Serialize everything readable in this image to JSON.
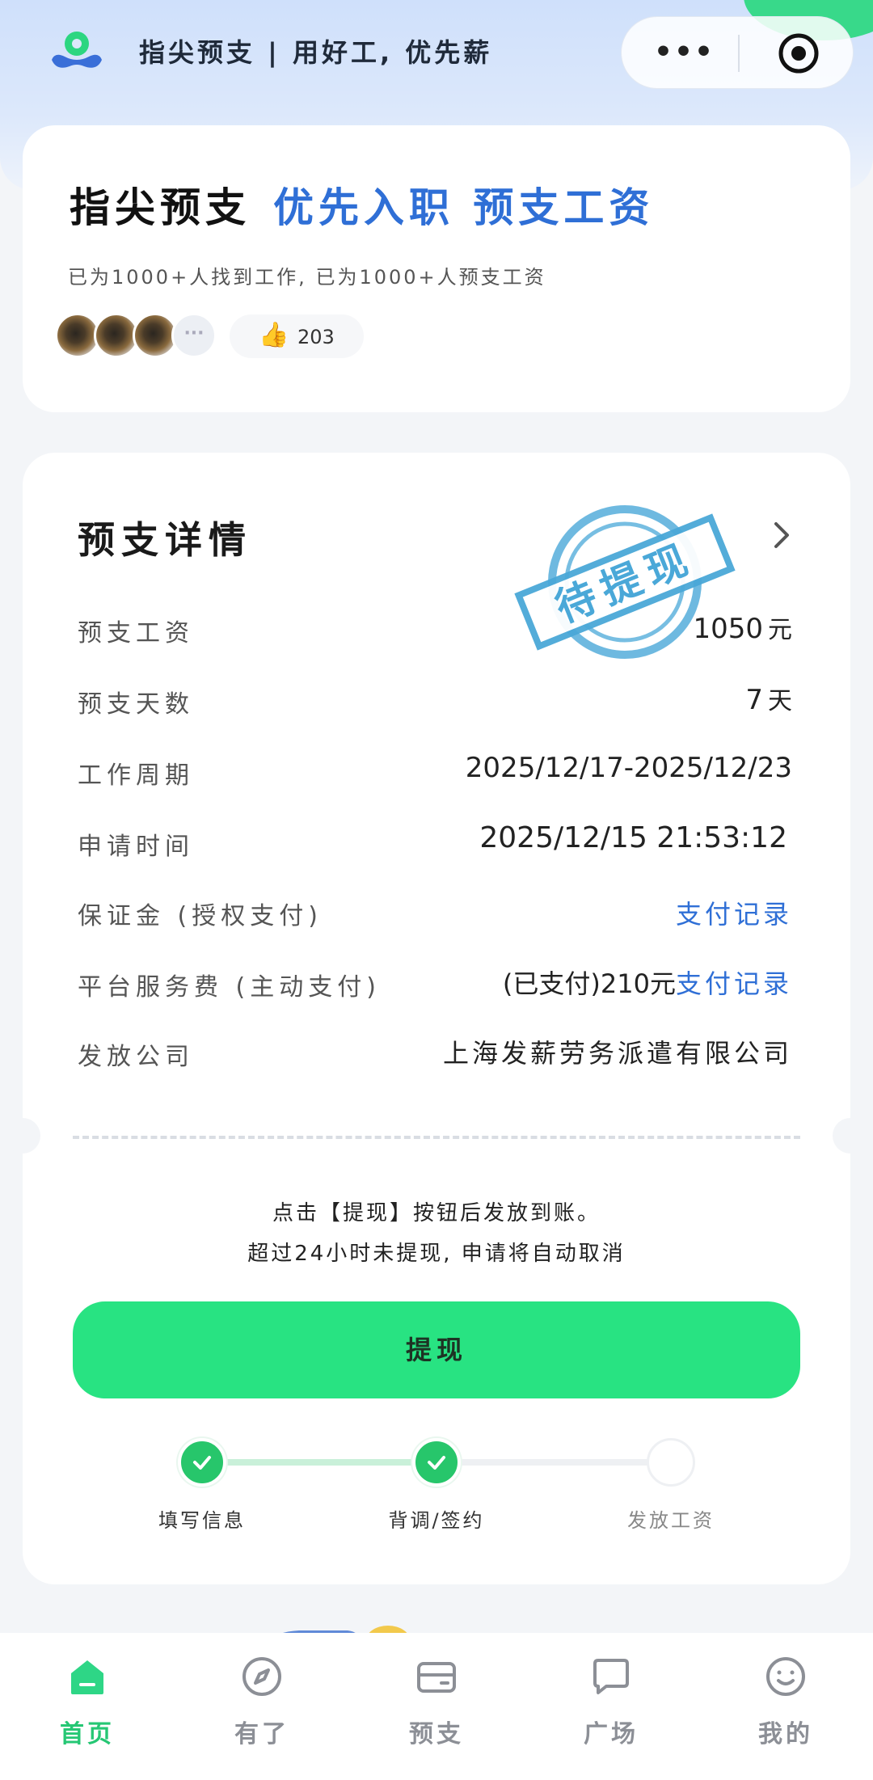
{
  "header": {
    "title": "指尖预支 | 用好工, 优先薪",
    "menu_glyph": "•••"
  },
  "hero": {
    "title_dark": "指尖预支",
    "title_blue": "优先入职 预支工资",
    "subtitle": "已为1000+人找到工作, 已为1000+人预支工资",
    "more_avatars": "···",
    "like_count": "203"
  },
  "detail": {
    "title": "预支详情",
    "stamp_text": "待提现",
    "rows": [
      {
        "label": "预支工资",
        "value": "1050",
        "unit": "元"
      },
      {
        "label": "预支天数",
        "value": "7",
        "unit": "天"
      },
      {
        "label": "工作周期",
        "value": "2025/12/17-2025/12/23"
      },
      {
        "label": "申请时间",
        "value": "2025/12/15  21:53:12"
      },
      {
        "label": "保证金 (授权支付)",
        "link": "支付记录"
      },
      {
        "label": "平台服务费 (主动支付)",
        "value": "(已支付)210元",
        "link": "支付记录"
      },
      {
        "label": "发放公司",
        "value": "上海发薪劳务派遣有限公司"
      }
    ],
    "tip_line1": "点击【提现】按钮后发放到账。",
    "tip_line2": "超过24小时未提现, 申请将自动取消",
    "button": "提现",
    "steps": [
      {
        "label": "填写信息",
        "done": true
      },
      {
        "label": "背调/签约",
        "done": true
      },
      {
        "label": "发放工资",
        "done": false
      }
    ]
  },
  "tabs": [
    {
      "label": "首页",
      "icon": "home-icon",
      "active": true
    },
    {
      "label": "有了",
      "icon": "compass-icon",
      "active": false
    },
    {
      "label": "预支",
      "icon": "wallet-icon",
      "active": false
    },
    {
      "label": "广场",
      "icon": "chat-icon",
      "active": false
    },
    {
      "label": "我的",
      "icon": "smile-icon",
      "active": false
    }
  ],
  "colors": {
    "accent_green": "#28e382",
    "link_blue": "#2f6fd6",
    "stamp_blue": "#4aa8d8"
  }
}
